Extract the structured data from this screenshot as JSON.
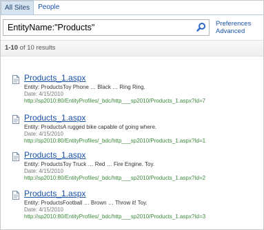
{
  "tabs": [
    "All Sites",
    "People"
  ],
  "search": {
    "value": "EntityName:\"Products\""
  },
  "side_links": {
    "preferences": "Preferences",
    "advanced": "Advanced"
  },
  "results_count": {
    "range": "1-10",
    "of_label": "of 10 results"
  },
  "results": [
    {
      "title": "Products_1.aspx",
      "summary": "Entity: ProductsToy Phone … Black … Ring Ring.",
      "date": "Date: 4/15/2010",
      "url": "http://sp2010:80/EntityProfiles/_bdc/http___sp2010/Products_1.aspx?Id=7"
    },
    {
      "title": "Products_1.aspx",
      "summary": "Entity: ProductsA rugged bike capable of going where.",
      "date": "Date: 4/15/2010",
      "url": "http://sp2010:80/EntityProfiles/_bdc/http___sp2010/Products_1.aspx?Id=1"
    },
    {
      "title": "Products_1.aspx",
      "summary": "Entity: ProductsToy Truck … Red … Fire Engine. Toy.",
      "date": "Date: 4/15/2010",
      "url": "http://sp2010:80/EntityProfiles/_bdc/http___sp2010/Products_1.aspx?Id=2"
    },
    {
      "title": "Products_1.aspx",
      "summary": "Entity: ProductsFootball … Brown … Throw it! Toy.",
      "date": "Date: 4/15/2010",
      "url": "http://sp2010:80/EntityProfiles/_bdc/http___sp2010/Products_1.aspx?Id=3"
    }
  ],
  "colors": {
    "link": "#1a52a8",
    "url_green": "#3a8a3a",
    "tab_active_bg": "#d6e3f1"
  },
  "icons": {
    "search": "search-icon",
    "document": "document-icon"
  }
}
